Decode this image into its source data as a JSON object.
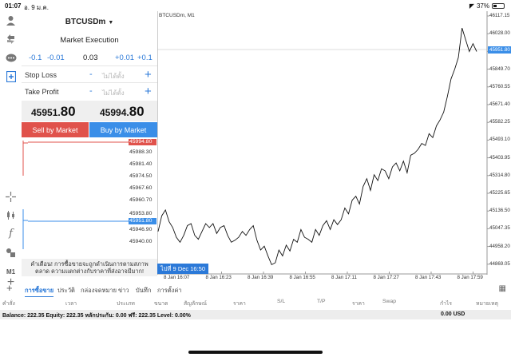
{
  "status": {
    "time": "01:07",
    "date": "อ. 9 ม.ค.",
    "battery": "37%",
    "battery_level": 0.37
  },
  "order": {
    "symbol": "BTCUSDm",
    "execution": "Market Execution",
    "steps": [
      "-0.1",
      "-0.01",
      "0.03",
      "+0.01",
      "+0.1"
    ],
    "stop_loss": {
      "label": "Stop Loss",
      "minus": "-",
      "value": "ไม่ได้ตั้ง",
      "plus": "+"
    },
    "take_profit": {
      "label": "Take Profit",
      "minus": "-",
      "value": "ไม่ได้ตั้ง",
      "plus": "+"
    },
    "bid": {
      "main": "45951.",
      "big": "80"
    },
    "ask": {
      "main": "45994.",
      "big": "80"
    },
    "sell_label": "Sell by Market",
    "buy_label": "Buy by Market"
  },
  "depth": {
    "ticks": [
      "45994.80",
      "45988.30",
      "45981.40",
      "45974.50",
      "45967.60",
      "45960.70",
      "45953.80",
      "45951.80",
      "45946.90",
      "45940.00"
    ],
    "ask_tag": "45994.80",
    "bid_tag": "45951.80",
    "colors": {
      "ask": "#e0524b",
      "bid": "#3a8ee8"
    }
  },
  "warning": "คำเตือน! การซื้อขายจะถูกดำเนินการตามสภาพตลาด ความแตกต่างกับราคาที่ส่งอาจมีมาก!",
  "chart": {
    "title": "BTCUSDm, M1",
    "current_price": "45951.80",
    "live_badge": "ไปที่ 9 Dec 16:50",
    "y_ticks": [
      "46117.15",
      "46028.00",
      "45938.85",
      "45849.70",
      "45760.55",
      "45671.40",
      "45582.25",
      "45493.10",
      "45403.95",
      "45314.80",
      "45225.65",
      "45136.50",
      "45047.35",
      "44958.20",
      "44869.05"
    ],
    "x_ticks": [
      "8 Jan 16:07",
      "8 Jan 16:23",
      "8 Jan 16:39",
      "8 Jan 16:55",
      "8 Jan 17:11",
      "8 Jan 17:27",
      "8 Jan 17:43",
      "8 Jan 17:59"
    ]
  },
  "chart_data": {
    "type": "line",
    "title": "BTCUSDm, M1",
    "ylim": [
      44825,
      46140
    ],
    "y": [
      45030,
      45110,
      45140,
      45080,
      45050,
      45000,
      44975,
      45010,
      45060,
      45070,
      45010,
      44990,
      45030,
      45070,
      45050,
      45070,
      45020,
      45050,
      45060,
      45010,
      44975,
      44985,
      45000,
      45030,
      45010,
      45040,
      45060,
      44985,
      44935,
      44955,
      44905,
      44860,
      44870,
      44935,
      44905,
      44960,
      44930,
      44990,
      44975,
      45040,
      45000,
      44990,
      44975,
      45040,
      45010,
      45060,
      45085,
      45040,
      45090,
      45065,
      45090,
      45150,
      45120,
      45190,
      45210,
      45170,
      45260,
      45300,
      45240,
      45320,
      45290,
      45350,
      45340,
      45300,
      45360,
      45380,
      45340,
      45390,
      45330,
      45420,
      45430,
      45450,
      45480,
      45470,
      45530,
      45510,
      45570,
      45600,
      45640,
      45720,
      45810,
      45860,
      45920,
      46070,
      46010,
      45950,
      45990,
      45950
    ]
  },
  "tabs": {
    "items": [
      "การซื้อขาย",
      "ประวัติ",
      "กล่องจดหมาย",
      "ข่าว",
      "บันทึก",
      "การตั้งค่า"
    ],
    "active": 0
  },
  "columns": [
    "คำสั่ง",
    "เวลา",
    "ประเภท",
    "ขนาด",
    "สัญลักษณ์",
    "ราคา",
    "S/L",
    "T/P",
    "ราคา",
    "Swap",
    "กำไร",
    "หมายเหตุ"
  ],
  "balance": {
    "text": "Balance: 222.35 Equity: 222.35 หลักประกัน: 0.00 ฟรี: 222.35 Level: 0.00%",
    "profit": "0.00  USD"
  },
  "toolbar": {
    "icons": [
      "user-icon",
      "transfer-icon",
      "chat-icon",
      "new-order-icon",
      "crosshair-icon",
      "candles-icon",
      "function-icon",
      "objects-icon",
      "timeframe-label",
      "add-icon"
    ],
    "timeframe": "M1"
  }
}
